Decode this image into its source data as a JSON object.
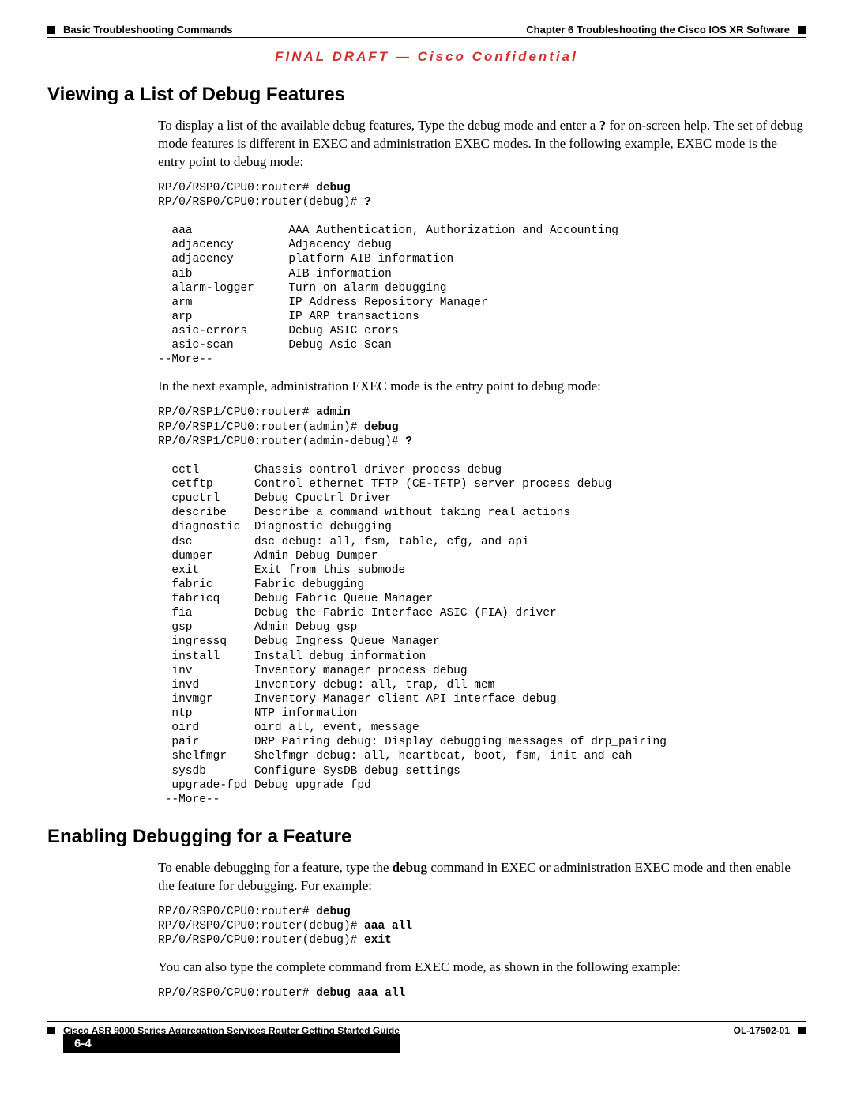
{
  "header": {
    "left": "Basic Troubleshooting Commands",
    "right": "Chapter 6    Troubleshooting the Cisco IOS XR Software"
  },
  "confidential": "FINAL DRAFT — Cisco Confidential",
  "section1": {
    "title": "Viewing a List of Debug Features",
    "para1_a": "To display a list of the available debug features, Type the debug mode and enter a ",
    "para1_b": "?",
    "para1_c": " for on-screen help. The set of debug mode features is different in EXEC and administration EXEC modes. In the following example, EXEC mode is the entry point to debug mode:",
    "cli1_l1_a": "RP/0/RSP0/CPU0:router# ",
    "cli1_l1_b": "debug",
    "cli1_l2_a": "RP/0/RSP0/CPU0:router(debug)# ",
    "cli1_l2_b": "?",
    "cli1_block": "\n  aaa              AAA Authentication, Authorization and Accounting\n  adjacency        Adjacency debug\n  adjacency        platform AIB information\n  aib              AIB information\n  alarm-logger     Turn on alarm debugging\n  arm              IP Address Repository Manager\n  arp              IP ARP transactions\n  asic-errors      Debug ASIC erors\n  asic-scan        Debug Asic Scan\n--More--",
    "para2": "In the next example, administration EXEC mode is the entry point to debug mode:",
    "cli2_l1_a": "RP/0/RSP1/CPU0:router# ",
    "cli2_l1_b": "admin",
    "cli2_l2_a": "RP/0/RSP1/CPU0:router(admin)# ",
    "cli2_l2_b": "debug",
    "cli2_l3_a": "RP/0/RSP1/CPU0:router(admin-debug)# ",
    "cli2_l3_b": "?",
    "cli2_block": "\n  cctl        Chassis control driver process debug\n  cetftp      Control ethernet TFTP (CE-TFTP) server process debug\n  cpuctrl     Debug Cpuctrl Driver\n  describe    Describe a command without taking real actions\n  diagnostic  Diagnostic debugging\n  dsc         dsc debug: all, fsm, table, cfg, and api\n  dumper      Admin Debug Dumper\n  exit        Exit from this submode\n  fabric      Fabric debugging\n  fabricq     Debug Fabric Queue Manager\n  fia         Debug the Fabric Interface ASIC (FIA) driver\n  gsp         Admin Debug gsp\n  ingressq    Debug Ingress Queue Manager\n  install     Install debug information\n  inv         Inventory manager process debug\n  invd        Inventory debug: all, trap, dll mem\n  invmgr      Inventory Manager client API interface debug\n  ntp         NTP information\n  oird        oird all, event, message\n  pair        DRP Pairing debug: Display debugging messages of drp_pairing\n  shelfmgr    Shelfmgr debug: all, heartbeat, boot, fsm, init and eah\n  sysdb       Configure SysDB debug settings\n  upgrade-fpd Debug upgrade fpd\n --More--"
  },
  "section2": {
    "title": "Enabling Debugging for a Feature",
    "para1_a": "To enable debugging for a feature, type the ",
    "para1_b": "debug",
    "para1_c": " command in EXEC or administration EXEC mode and then enable the feature for debugging. For example:",
    "cli3_l1_a": "RP/0/RSP0/CPU0:router# ",
    "cli3_l1_b": "debug",
    "cli3_l2_a": "RP/0/RSP0/CPU0:router(debug)# ",
    "cli3_l2_b": "aaa all",
    "cli3_l3_a": "RP/0/RSP0/CPU0:router(debug)# ",
    "cli3_l3_b": "exit",
    "para2": "You can also type the complete command from EXEC mode, as shown in the following example:",
    "cli4_l1_a": "RP/0/RSP0/CPU0:router# ",
    "cli4_l1_b": "debug aaa all"
  },
  "footer": {
    "title": "Cisco ASR 9000 Series Aggregation Services Router Getting Started Guide",
    "page": "6-4",
    "docnum": "OL-17502-01"
  }
}
